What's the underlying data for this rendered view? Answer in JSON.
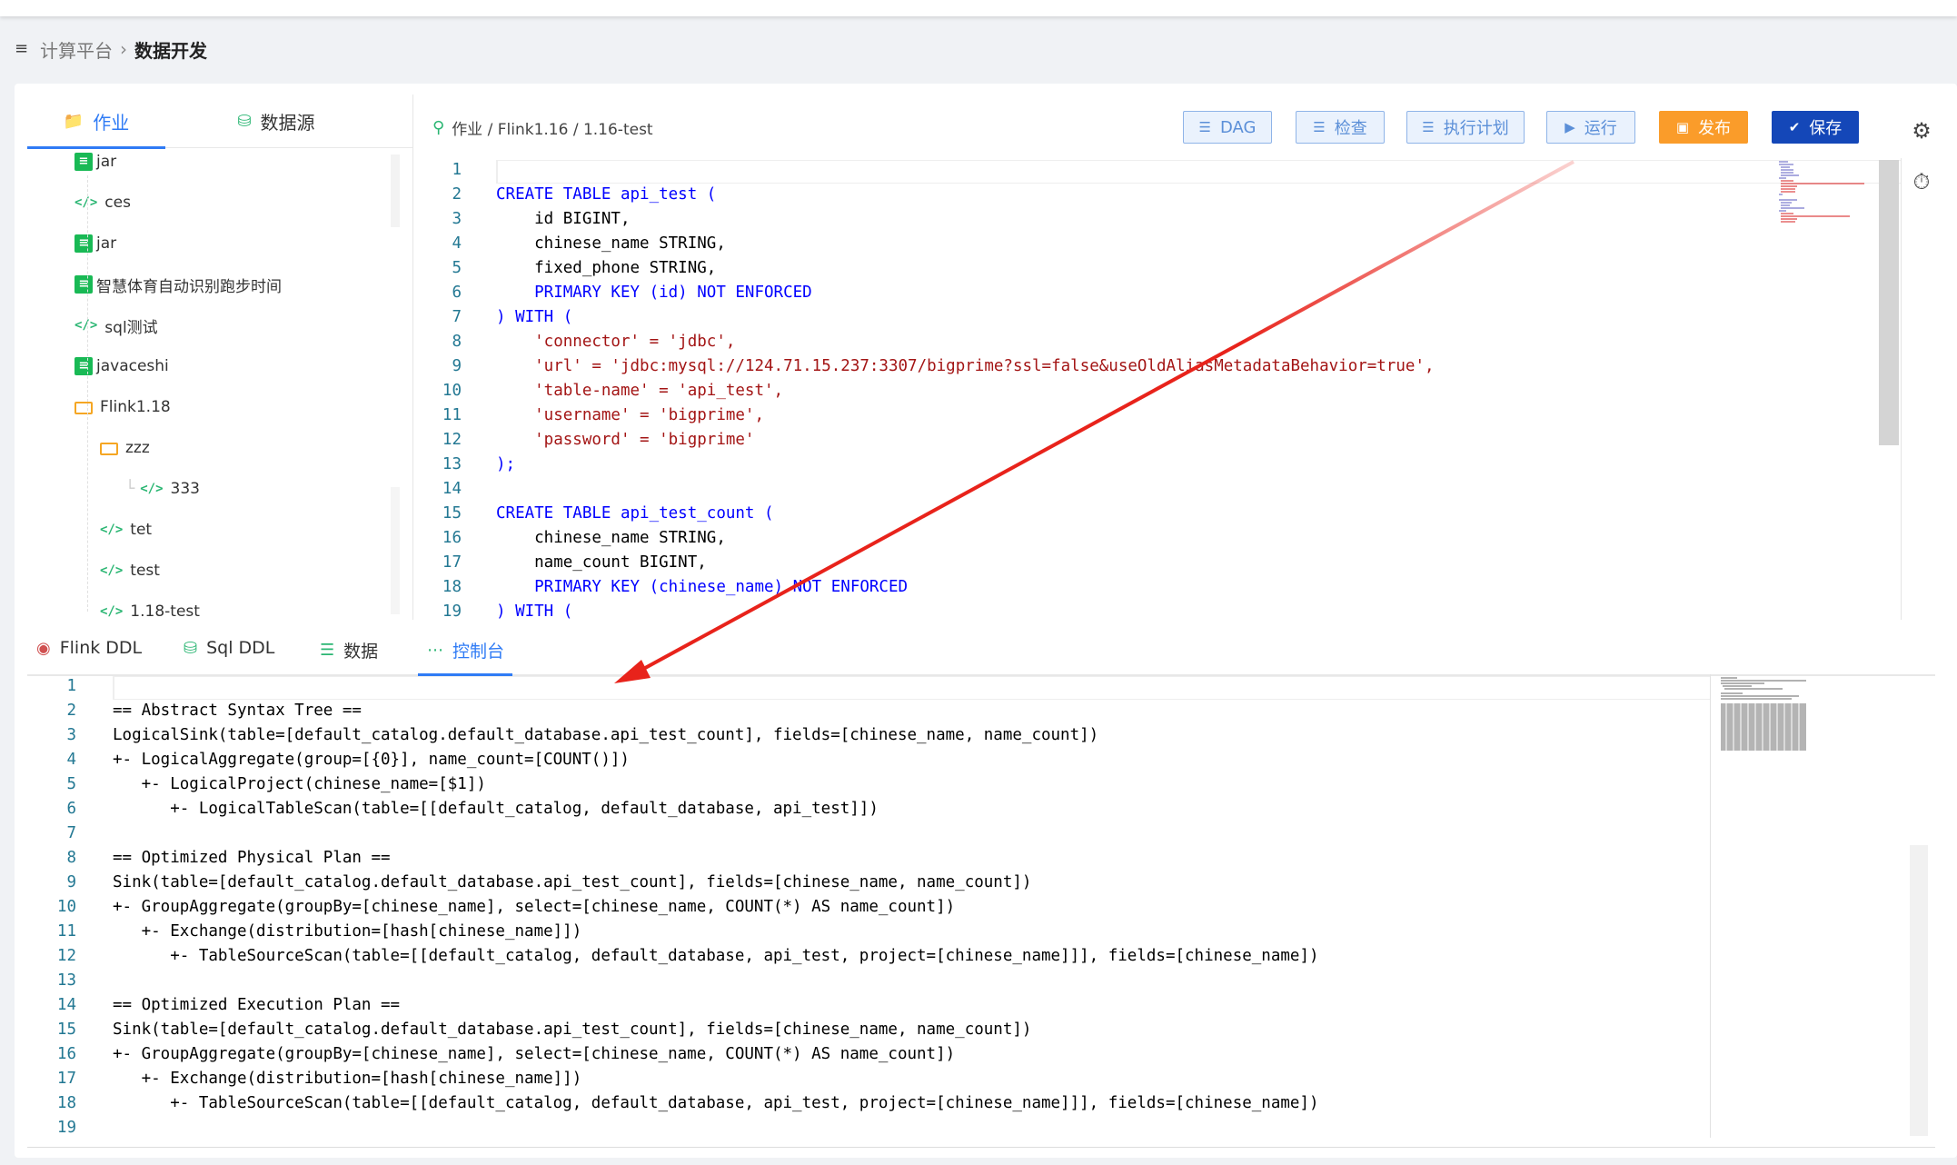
{
  "breadcrumb": {
    "root": "计算平台",
    "current": "数据开发"
  },
  "left_panel": {
    "tabs": [
      {
        "label": "作业",
        "icon": "folder-icon"
      },
      {
        "label": "数据源",
        "icon": "database-icon"
      }
    ],
    "tree": [
      {
        "label": "jar",
        "icon": "jar-icon"
      },
      {
        "label": "ces",
        "icon": "code-icon"
      },
      {
        "label": "jar",
        "icon": "jar-icon"
      },
      {
        "label": "智慧体育自动识别跑步时间",
        "icon": "jar-icon"
      },
      {
        "label": "sql测试",
        "icon": "code-icon"
      },
      {
        "label": "javaceshi",
        "icon": "jar-icon"
      },
      {
        "label": "Flink1.18",
        "icon": "folder-icon"
      },
      {
        "label": "zzz",
        "icon": "folder-icon"
      },
      {
        "label": "333",
        "icon": "code-icon"
      },
      {
        "label": "tet",
        "icon": "code-icon"
      },
      {
        "label": "test",
        "icon": "code-icon"
      },
      {
        "label": "1.18-test",
        "icon": "code-icon"
      }
    ]
  },
  "editor_header": {
    "path": "作业 / Flink1.16 / 1.16-test",
    "buttons": [
      {
        "label": "DAG",
        "icon": "list-icon"
      },
      {
        "label": "检查",
        "icon": "list-icon"
      },
      {
        "label": "执行计划",
        "icon": "list-icon"
      },
      {
        "label": "运行",
        "icon": "play-icon"
      },
      {
        "label": "发布",
        "icon": "lock-icon"
      },
      {
        "label": "保存",
        "icon": "check-icon"
      }
    ]
  },
  "editor": {
    "lines": [
      {
        "n": "1",
        "t": ""
      },
      {
        "n": "2",
        "t": "CREATE TABLE api_test ("
      },
      {
        "n": "3",
        "t": "    id BIGINT,"
      },
      {
        "n": "4",
        "t": "    chinese_name STRING,"
      },
      {
        "n": "5",
        "t": "    fixed_phone STRING,"
      },
      {
        "n": "6",
        "t": "    PRIMARY KEY (id) NOT ENFORCED"
      },
      {
        "n": "7",
        "t": ") WITH ("
      },
      {
        "n": "8",
        "t": "    'connector' = 'jdbc',"
      },
      {
        "n": "9",
        "t": "    'url' = 'jdbc:mysql://124.71.15.237:3307/bigprime?ssl=false&useOldAliasMetadataBehavior=true',"
      },
      {
        "n": "10",
        "t": "    'table-name' = 'api_test',"
      },
      {
        "n": "11",
        "t": "    'username' = 'bigprime',"
      },
      {
        "n": "12",
        "t": "    'password' = 'bigprime'"
      },
      {
        "n": "13",
        "t": ");"
      },
      {
        "n": "14",
        "t": ""
      },
      {
        "n": "15",
        "t": "CREATE TABLE api_test_count ("
      },
      {
        "n": "16",
        "t": "    chinese_name STRING,"
      },
      {
        "n": "17",
        "t": "    name_count BIGINT,"
      },
      {
        "n": "18",
        "t": "    PRIMARY KEY (chinese_name) NOT ENFORCED"
      },
      {
        "n": "19",
        "t": ") WITH ("
      }
    ]
  },
  "bottom_tabs": [
    {
      "label": "Flink DDL",
      "icon": "squirrel-icon"
    },
    {
      "label": "Sql DDL",
      "icon": "database-icon"
    },
    {
      "label": "数据",
      "icon": "list-icon"
    },
    {
      "label": "控制台",
      "icon": "console-icon"
    }
  ],
  "console": {
    "lines": [
      {
        "n": "1",
        "t": ""
      },
      {
        "n": "2",
        "t": "== Abstract Syntax Tree =="
      },
      {
        "n": "3",
        "t": "LogicalSink(table=[default_catalog.default_database.api_test_count], fields=[chinese_name, name_count])"
      },
      {
        "n": "4",
        "t": "+- LogicalAggregate(group=[{0}], name_count=[COUNT()])"
      },
      {
        "n": "5",
        "t": "   +- LogicalProject(chinese_name=[$1])"
      },
      {
        "n": "6",
        "t": "      +- LogicalTableScan(table=[[default_catalog, default_database, api_test]])"
      },
      {
        "n": "7",
        "t": ""
      },
      {
        "n": "8",
        "t": "== Optimized Physical Plan =="
      },
      {
        "n": "9",
        "t": "Sink(table=[default_catalog.default_database.api_test_count], fields=[chinese_name, name_count])"
      },
      {
        "n": "10",
        "t": "+- GroupAggregate(groupBy=[chinese_name], select=[chinese_name, COUNT(*) AS name_count])"
      },
      {
        "n": "11",
        "t": "   +- Exchange(distribution=[hash[chinese_name]])"
      },
      {
        "n": "12",
        "t": "      +- TableSourceScan(table=[[default_catalog, default_database, api_test, project=[chinese_name]]], fields=[chinese_name])"
      },
      {
        "n": "13",
        "t": ""
      },
      {
        "n": "14",
        "t": "== Optimized Execution Plan =="
      },
      {
        "n": "15",
        "t": "Sink(table=[default_catalog.default_database.api_test_count], fields=[chinese_name, name_count])"
      },
      {
        "n": "16",
        "t": "+- GroupAggregate(groupBy=[chinese_name], select=[chinese_name, COUNT(*) AS name_count])"
      },
      {
        "n": "17",
        "t": "   +- Exchange(distribution=[hash[chinese_name]])"
      },
      {
        "n": "18",
        "t": "      +- TableSourceScan(table=[[default_catalog, default_database, api_test, project=[chinese_name]]], fields=[chinese_name])"
      },
      {
        "n": "19",
        "t": ""
      }
    ]
  },
  "colors": {
    "accent": "#2f7bf5",
    "orange": "#fa9c2a",
    "save_blue": "#1447b8",
    "annotation_arrow": "#e8231b"
  }
}
